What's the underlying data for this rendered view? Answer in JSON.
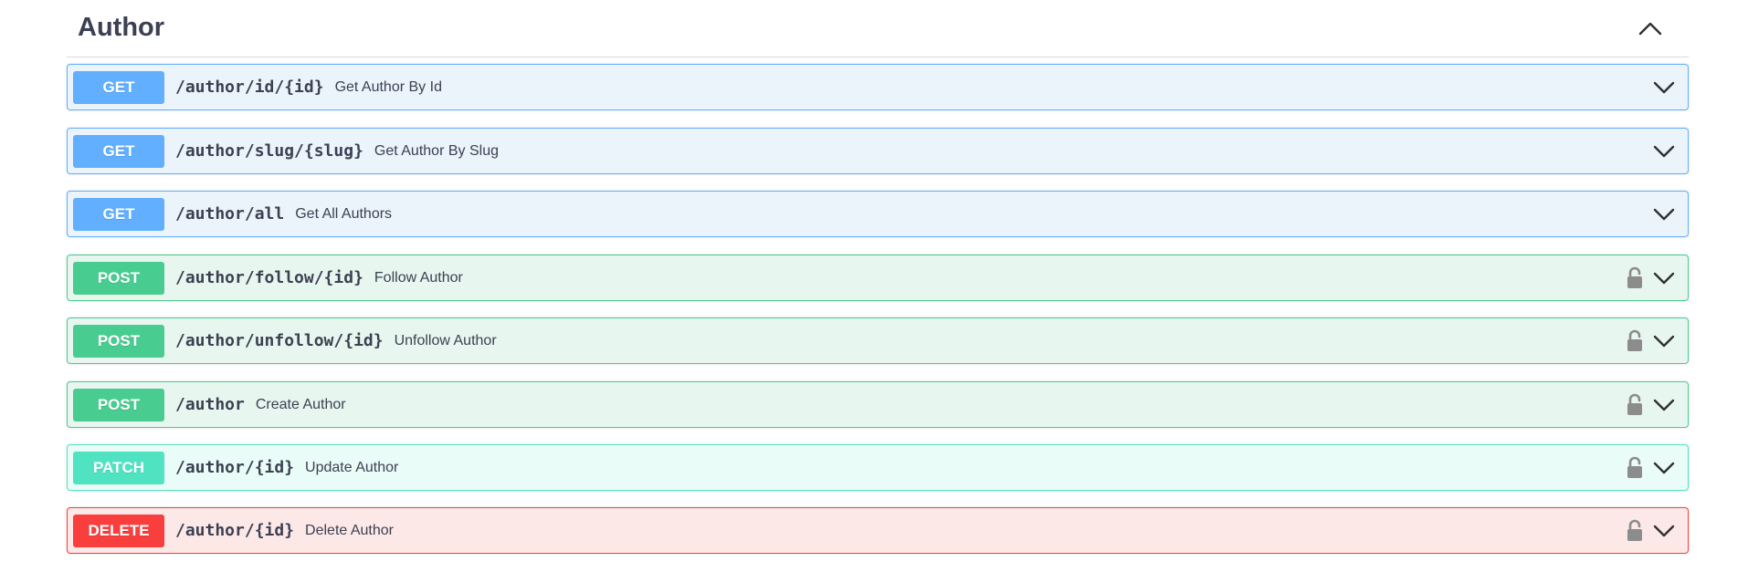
{
  "section": {
    "title": "Author"
  },
  "operations": [
    {
      "method": "GET",
      "path": "/author/id/{id}",
      "summary": "Get Author By Id",
      "locked": false,
      "colors": {
        "badge": "#61affe",
        "bg": "#ebf3fb",
        "border": "#61affe"
      }
    },
    {
      "method": "GET",
      "path": "/author/slug/{slug}",
      "summary": "Get Author By Slug",
      "locked": false,
      "colors": {
        "badge": "#61affe",
        "bg": "#ebf3fb",
        "border": "#61affe"
      }
    },
    {
      "method": "GET",
      "path": "/author/all",
      "summary": "Get All Authors",
      "locked": false,
      "colors": {
        "badge": "#61affe",
        "bg": "#ebf3fb",
        "border": "#61affe"
      }
    },
    {
      "method": "POST",
      "path": "/author/follow/{id}",
      "summary": "Follow Author",
      "locked": true,
      "colors": {
        "badge": "#49cc90",
        "bg": "#e8f6f0",
        "border": "#49cc90"
      }
    },
    {
      "method": "POST",
      "path": "/author/unfollow/{id}",
      "summary": "Unfollow Author",
      "locked": true,
      "colors": {
        "badge": "#49cc90",
        "bg": "#e8f6f0",
        "border": "#49cc90"
      }
    },
    {
      "method": "POST",
      "path": "/author",
      "summary": "Create Author",
      "locked": true,
      "colors": {
        "badge": "#49cc90",
        "bg": "#e8f6f0",
        "border": "#49cc90"
      }
    },
    {
      "method": "PATCH",
      "path": "/author/{id}",
      "summary": "Update Author",
      "locked": true,
      "colors": {
        "badge": "#50e3c2",
        "bg": "#e9fcf7",
        "border": "#50e3c2"
      }
    },
    {
      "method": "DELETE",
      "path": "/author/{id}",
      "summary": "Delete Author",
      "locked": true,
      "colors": {
        "badge": "#f93e3e",
        "bg": "#fde8e8",
        "border": "#f93e3e"
      }
    }
  ],
  "icons": {
    "collapse": "chevron-up-icon",
    "expand": "chevron-down-icon",
    "lock": "lock-open-icon"
  }
}
